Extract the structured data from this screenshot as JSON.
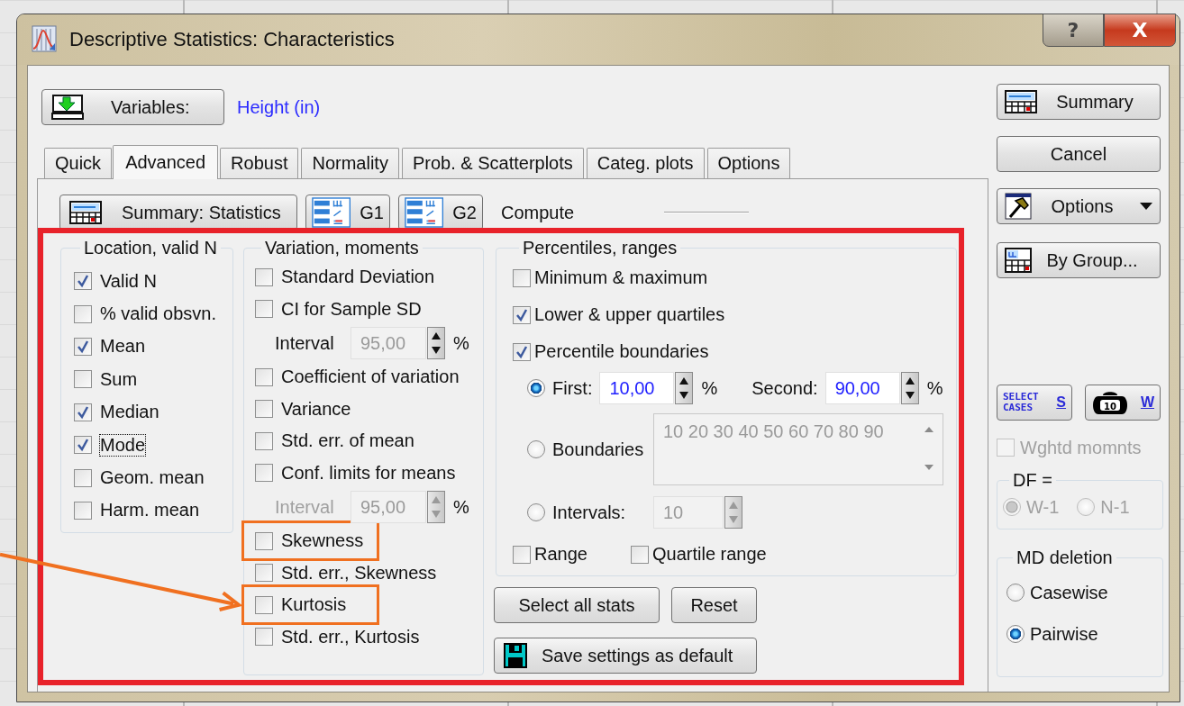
{
  "window": {
    "title": "Descriptive Statistics: Characteristics",
    "help_button": "?",
    "close_button": "X"
  },
  "variables": {
    "button": "Variables:",
    "value": "Height (in)"
  },
  "tabs": [
    {
      "label": "Quick",
      "selected": false
    },
    {
      "label": "Advanced",
      "selected": true
    },
    {
      "label": "Robust",
      "selected": false
    },
    {
      "label": "Normality",
      "selected": false
    },
    {
      "label": "Prob. & Scatterplots",
      "selected": false
    },
    {
      "label": "Categ. plots",
      "selected": false
    },
    {
      "label": "Options",
      "selected": false
    }
  ],
  "toolbar": {
    "summary_button": "Summary: Statistics",
    "graph_buttons": [
      "G1",
      "G2"
    ],
    "compute_label": "Compute"
  },
  "panel": {
    "highlighted": true,
    "location": {
      "title": "Location, valid N",
      "items": [
        {
          "label": "Valid N",
          "checked": true,
          "focused": false
        },
        {
          "label": "% valid obsvn.",
          "checked": false,
          "focused": false
        },
        {
          "label": "Mean",
          "checked": true,
          "focused": false
        },
        {
          "label": "Sum",
          "checked": false,
          "focused": false
        },
        {
          "label": "Median",
          "checked": true,
          "focused": false
        },
        {
          "label": "Mode",
          "checked": true,
          "focused": true
        },
        {
          "label": "Geom. mean",
          "checked": false,
          "focused": false
        },
        {
          "label": "Harm. mean",
          "checked": false,
          "focused": false
        }
      ]
    },
    "variation": {
      "title": "Variation, moments",
      "items": [
        {
          "kind": "checkbox",
          "label": "Standard Deviation",
          "checked": false,
          "highlighted": false,
          "pointed": false
        },
        {
          "kind": "checkbox",
          "label": "CI for Sample SD",
          "checked": false,
          "highlighted": false,
          "pointed": false
        },
        {
          "kind": "spinner",
          "label": "Interval",
          "value": "95,00",
          "unit": "%",
          "disabled": false,
          "field_disabled": true
        },
        {
          "kind": "checkbox",
          "label": "Coefficient of variation",
          "checked": false,
          "highlighted": false,
          "pointed": false
        },
        {
          "kind": "checkbox",
          "label": "Variance",
          "checked": false,
          "highlighted": false,
          "pointed": false
        },
        {
          "kind": "checkbox",
          "label": "Std. err. of mean",
          "checked": false,
          "highlighted": false,
          "pointed": false
        },
        {
          "kind": "checkbox",
          "label": "Conf. limits for means",
          "checked": false,
          "highlighted": false,
          "pointed": false
        },
        {
          "kind": "spinner",
          "label": "Interval",
          "value": "95,00",
          "unit": "%",
          "disabled": true,
          "field_disabled": true
        },
        {
          "kind": "checkbox",
          "label": "Skewness",
          "checked": false,
          "highlighted": true,
          "pointed": false
        },
        {
          "kind": "checkbox",
          "label": "Std. err., Skewness",
          "checked": false,
          "highlighted": false,
          "pointed": false
        },
        {
          "kind": "checkbox",
          "label": "Kurtosis",
          "checked": false,
          "highlighted": true,
          "pointed": true
        },
        {
          "kind": "checkbox",
          "label": "Std. err., Kurtosis",
          "checked": false,
          "highlighted": false,
          "pointed": false
        }
      ]
    },
    "percentiles": {
      "title": "Percentiles, ranges",
      "checks": [
        {
          "label": "Minimum & maximum",
          "checked": false
        },
        {
          "label": "Lower & upper quartiles",
          "checked": true
        },
        {
          "label": "Percentile boundaries",
          "checked": true
        }
      ],
      "options": [
        {
          "kind": "pair",
          "selected": true,
          "fields": [
            {
              "label": "First:",
              "value": "10,00",
              "unit": "%"
            },
            {
              "label": "Second:",
              "value": "90,00",
              "unit": "%"
            }
          ]
        },
        {
          "kind": "list",
          "label": "Boundaries",
          "selected": false,
          "value": "10 20 30 40 50 60 70 80 90"
        },
        {
          "kind": "spinner",
          "label": "Intervals:",
          "selected": false,
          "value": "10"
        }
      ],
      "bottom_checks": [
        {
          "label": "Range",
          "checked": false
        },
        {
          "label": "Quartile range",
          "checked": false
        }
      ]
    },
    "actions": [
      {
        "kind": "plain",
        "label": "Select all stats"
      },
      {
        "kind": "plain",
        "label": "Reset"
      },
      {
        "kind": "save",
        "label": "Save settings as default"
      }
    ]
  },
  "side_buttons": [
    {
      "label": "Summary",
      "kind": "summary",
      "menu": false
    },
    {
      "label": "Cancel",
      "kind": "plain",
      "menu": false
    },
    {
      "label": "Options",
      "kind": "tools",
      "menu": true
    },
    {
      "label": "By Group...",
      "kind": "bygroup",
      "menu": false
    }
  ],
  "case_buttons": [
    {
      "kind": "select_cases",
      "text": "SELECT CASES",
      "label": "S"
    },
    {
      "kind": "weight",
      "icon_text": "10",
      "label": "W"
    }
  ],
  "weighted_moments": {
    "label": "Wghtd momnts",
    "checked": false,
    "disabled": true
  },
  "df": {
    "title": "DF =",
    "disabled": true,
    "options": [
      {
        "label": "W-1",
        "selected": true
      },
      {
        "label": "N-1",
        "selected": false
      }
    ]
  },
  "md_deletion": {
    "title": "MD deletion",
    "options": [
      {
        "label": "Casewise",
        "selected": false
      },
      {
        "label": "Pairwise",
        "selected": true
      }
    ]
  }
}
